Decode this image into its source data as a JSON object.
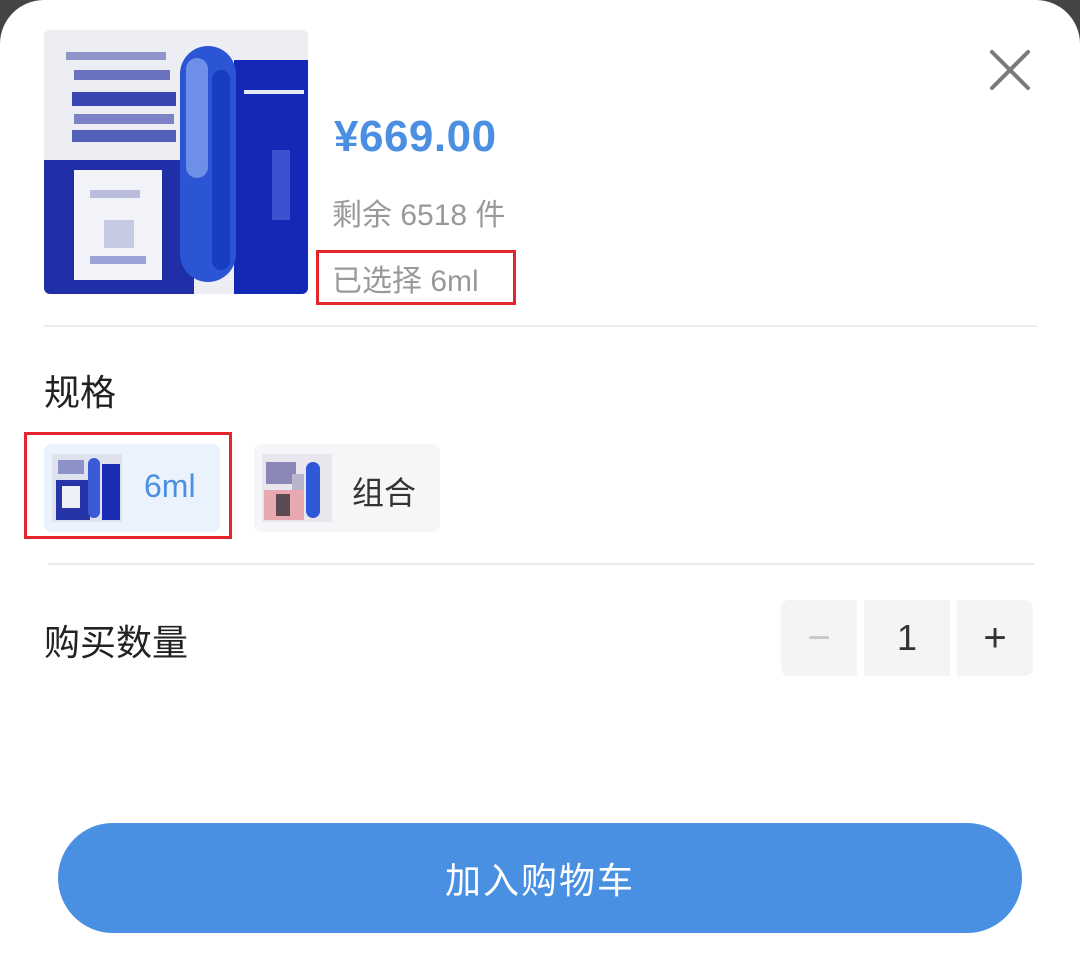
{
  "product": {
    "price": "¥669.00",
    "stock_text": "剩余 6518 件",
    "selected_text": "已选择 6ml",
    "image_icon": "product-photo-blurred"
  },
  "spec": {
    "title": "规格",
    "options": [
      {
        "label": "6ml",
        "selected": true
      },
      {
        "label": "组合",
        "selected": false
      }
    ]
  },
  "quantity": {
    "title": "购买数量",
    "value": "1",
    "minus_label": "−",
    "plus_label": "+"
  },
  "actions": {
    "add_to_cart": "加入购物车"
  },
  "colors": {
    "accent": "#4a90e2",
    "price": "#4a8fe2",
    "highlight_border": "#e2262c"
  }
}
